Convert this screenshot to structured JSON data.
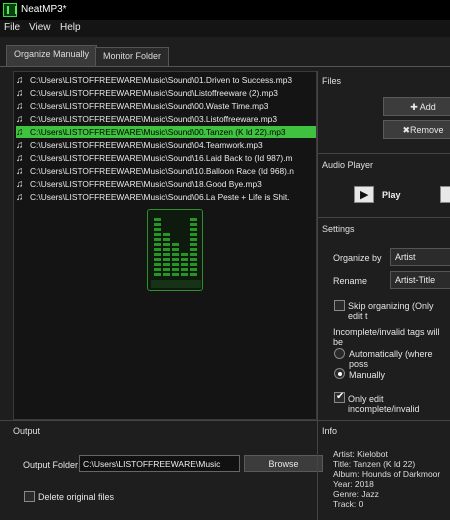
{
  "window": {
    "title": "NeatMP3*"
  },
  "menu": [
    "File",
    "View",
    "Help"
  ],
  "tabs": [
    {
      "label": "Organize Manually",
      "active": true
    },
    {
      "label": "Monitor Folder",
      "active": false
    }
  ],
  "files": [
    {
      "path": "C:\\Users\\LISTOFFREEWARE\\Music\\Sound\\01.Driven to Success.mp3",
      "selected": false
    },
    {
      "path": "C:\\Users\\LISTOFFREEWARE\\Music\\Sound\\Listoffreeware (2).mp3",
      "selected": false
    },
    {
      "path": "C:\\Users\\LISTOFFREEWARE\\Music\\Sound\\00.Waste Time.mp3",
      "selected": false
    },
    {
      "path": "C:\\Users\\LISTOFFREEWARE\\Music\\Sound\\03.Listoffreeware.mp3",
      "selected": false
    },
    {
      "path": "C:\\Users\\LISTOFFREEWARE\\Music\\Sound\\00.Tanzen (K ld 22).mp3",
      "selected": true
    },
    {
      "path": "C:\\Users\\LISTOFFREEWARE\\Music\\Sound\\04.Teamwork.mp3",
      "selected": false
    },
    {
      "path": "C:\\Users\\LISTOFFREEWARE\\Music\\Sound\\16.Laid Back to (Id 987).m",
      "selected": false
    },
    {
      "path": "C:\\Users\\LISTOFFREEWARE\\Music\\Sound\\10.Balloon Race (Id 968).n",
      "selected": false
    },
    {
      "path": "C:\\Users\\LISTOFFREEWARE\\Music\\Sound\\18.Good Bye.mp3",
      "selected": false
    },
    {
      "path": "C:\\Users\\LISTOFFREEWARE\\Music\\Sound\\06.La Peste + Life is Shit.",
      "selected": false
    }
  ],
  "files_panel": {
    "title": "Files",
    "add": "Add",
    "remove": "Remove"
  },
  "audio_player": {
    "title": "Audio Player",
    "play": "Play"
  },
  "settings": {
    "title": "Settings",
    "organize_by_label": "Organize by",
    "organize_by_value": "Artist",
    "rename_label": "Rename",
    "rename_value": "Artist-Title",
    "skip_organizing": "Skip organizing (Only edit t",
    "incomplete_label": "Incomplete/invalid tags will be",
    "auto_option": "Automatically (where poss",
    "manual_option": "Manually",
    "only_edit": "Only edit incomplete/invalid"
  },
  "output": {
    "title": "Output",
    "folder_label": "Output Folder",
    "folder_value": "C:\\Users\\LISTOFFREEWARE\\Music",
    "browse": "Browse",
    "delete_originals": "Delete original files"
  },
  "info": {
    "title": "Info",
    "artist": "Artist: Kielobot",
    "title_line": "Title: Tanzen (K ld 22)",
    "album": "Album: Hounds of Darkmoor",
    "year": "Year: 2018",
    "genre": "Genre: Jazz",
    "track": "Track: 0"
  },
  "colors": {
    "selection": "#3fc23f",
    "logo_green": "#3ddc3d"
  }
}
